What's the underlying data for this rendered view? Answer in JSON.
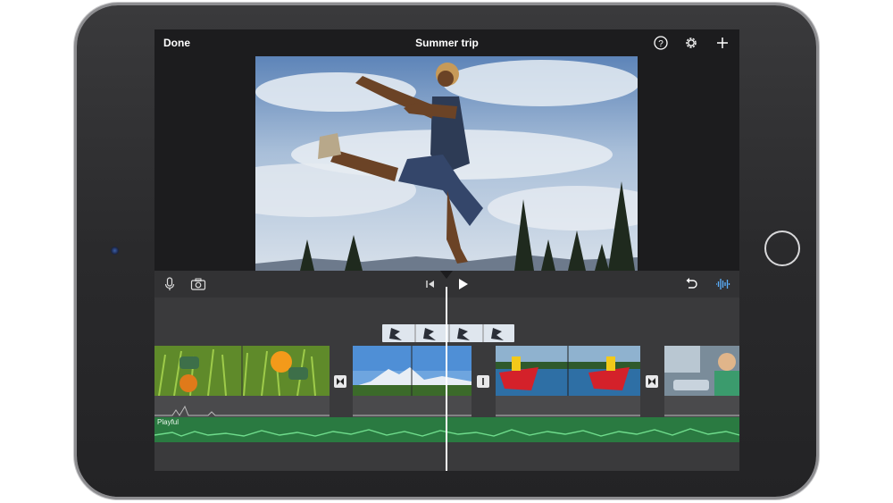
{
  "app": {
    "title": "Summer trip",
    "done_label": "Done"
  },
  "toolbar": {
    "help_icon": "question-circle-icon",
    "settings_icon": "gear-icon",
    "add_icon": "plus-icon"
  },
  "timeline_toolbar": {
    "mic_icon": "microphone-icon",
    "camera_icon": "camera-icon",
    "skip_back_icon": "skip-to-start-icon",
    "play_icon": "play-icon",
    "undo_icon": "undo-icon",
    "audio_icon": "waveform-icon"
  },
  "timeline": {
    "music_track_label": "Playful",
    "clips": [
      {
        "name": "clip-grass-ball"
      },
      {
        "name": "clip-mountain-lake"
      },
      {
        "name": "clip-kayaks"
      },
      {
        "name": "clip-car-kid"
      }
    ]
  },
  "colors": {
    "screen_bg": "#1c1c1e",
    "timeline_bg": "#3a3a3c",
    "music_track": "#2a7a41",
    "accent": "#5ab0ff"
  }
}
